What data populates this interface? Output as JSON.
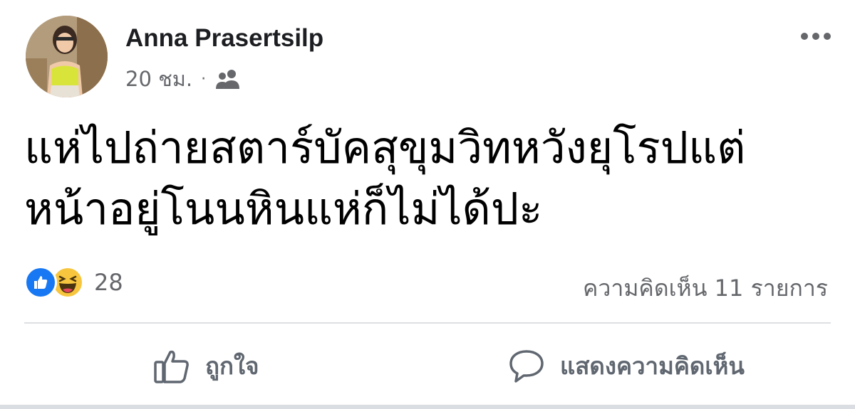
{
  "post": {
    "author": "Anna Prasertsilp",
    "time": "20 ชม.",
    "separator": "·",
    "audience_icon": "friends-icon",
    "text_lines": [
      "แห่ไปถ่ายสตาร์บัคสุขุมวิทหวังยุโรปแต่",
      "หน้าอยู่โนนหินแห่ก็ไม่ได้ปะ"
    ]
  },
  "reactions": {
    "icons": [
      "like-reaction-icon",
      "haha-reaction-icon"
    ],
    "count": "28"
  },
  "comments": {
    "summary": "ความคิดเห็น 11 รายการ"
  },
  "actions": {
    "like_label": "ถูกใจ",
    "comment_label": "แสดงความคิดเห็น"
  },
  "colors": {
    "like_blue": "#1877f2",
    "haha_yellow": "#f7c63e",
    "secondary_text": "#65676b"
  }
}
